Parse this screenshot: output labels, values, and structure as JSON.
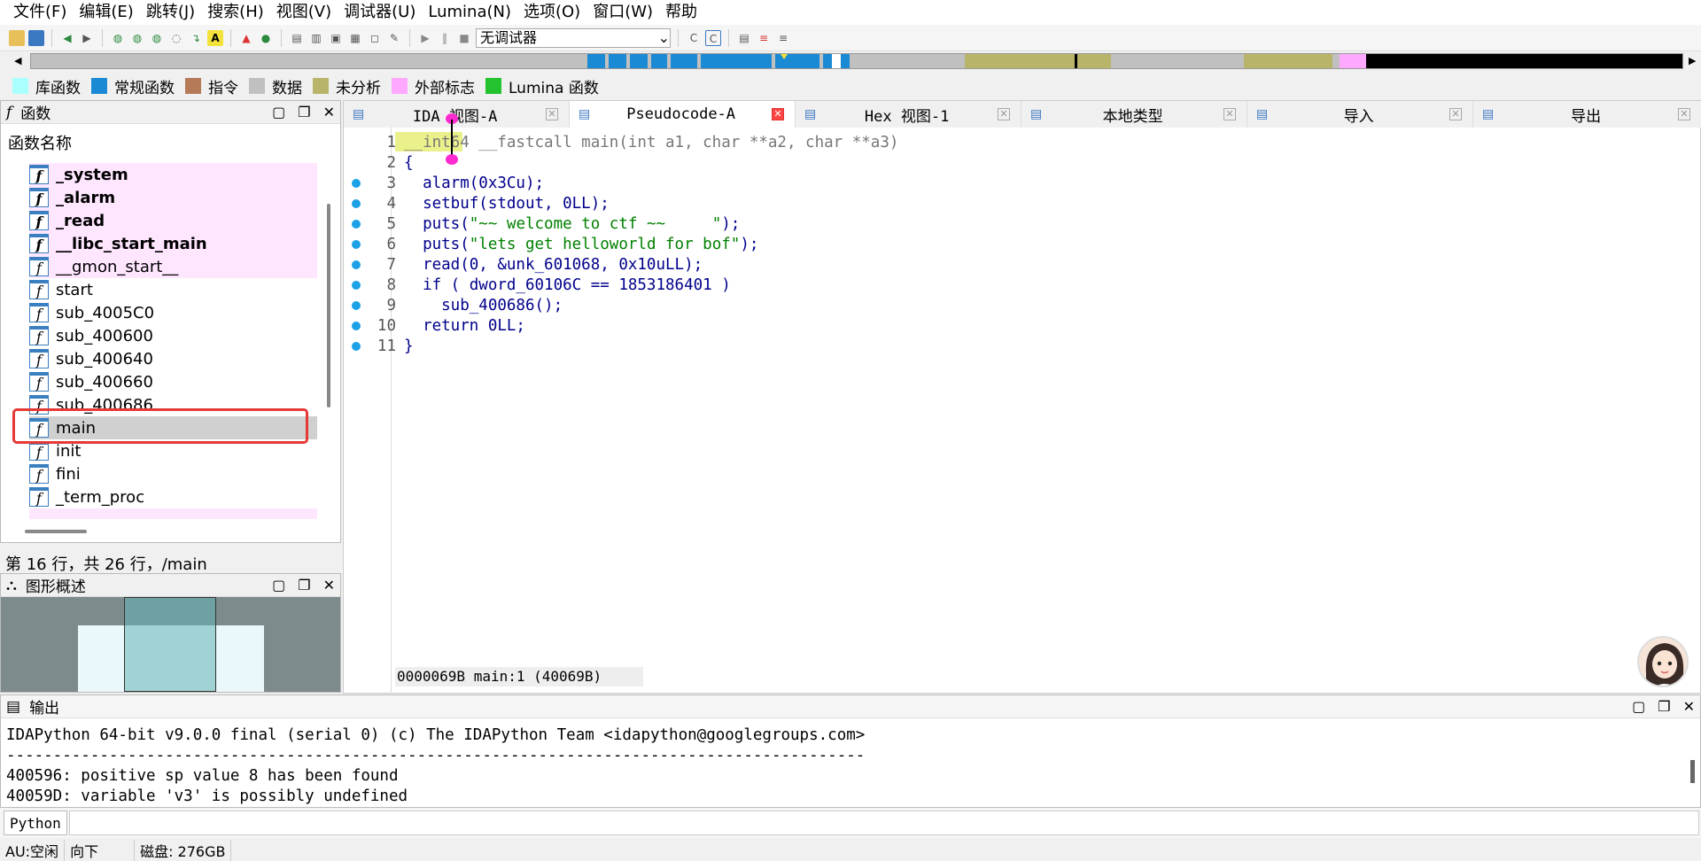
{
  "menu": [
    "文件(F)",
    "编辑(E)",
    "跳转(J)",
    "搜索(H)",
    "视图(V)",
    "调试器(U)",
    "Lumina(N)",
    "选项(O)",
    "窗口(W)",
    "帮助"
  ],
  "toolbar": {
    "debugger_select": "无调试器"
  },
  "legend": [
    {
      "label": "库函数",
      "color": "#aaffff"
    },
    {
      "label": "常规函数",
      "color": "#1a8ad4"
    },
    {
      "label": "指令",
      "color": "#b57a57"
    },
    {
      "label": "数据",
      "color": "#c0c0c0"
    },
    {
      "label": "未分析",
      "color": "#b8b56a"
    },
    {
      "label": "外部标志",
      "color": "#ffa8ff"
    },
    {
      "label": "Lumina 函数",
      "color": "#22c32e"
    }
  ],
  "functions_panel": {
    "title": "函数",
    "column_header": "函数名称",
    "items": [
      {
        "name": "_system",
        "lib": true,
        "bold": true
      },
      {
        "name": "_alarm",
        "lib": true,
        "bold": true
      },
      {
        "name": "_read",
        "lib": true,
        "bold": true
      },
      {
        "name": "__libc_start_main",
        "lib": true,
        "bold": true
      },
      {
        "name": "__gmon_start__",
        "lib": true,
        "bold": false
      },
      {
        "name": "start",
        "lib": false,
        "bold": false
      },
      {
        "name": "sub_4005C0",
        "lib": false,
        "bold": false
      },
      {
        "name": "sub_400600",
        "lib": false,
        "bold": false
      },
      {
        "name": "sub_400640",
        "lib": false,
        "bold": false
      },
      {
        "name": "sub_400660",
        "lib": false,
        "bold": false
      },
      {
        "name": "sub_400686",
        "lib": false,
        "bold": false
      },
      {
        "name": "main",
        "lib": false,
        "bold": false,
        "selected": true
      },
      {
        "name": "init",
        "lib": false,
        "bold": false
      },
      {
        "name": "fini",
        "lib": false,
        "bold": false
      },
      {
        "name": "_term_proc",
        "lib": false,
        "bold": false
      }
    ],
    "status": "第 16 行，共 26 行，/main"
  },
  "graph_panel": {
    "title": "图形概述"
  },
  "tabs": [
    {
      "label": "IDA 视图-A",
      "active": false
    },
    {
      "label": "Pseudocode-A",
      "active": true
    },
    {
      "label": "Hex 视图-1",
      "active": false
    },
    {
      "label": "本地类型",
      "active": false
    },
    {
      "label": "导入",
      "active": false
    },
    {
      "label": "导出",
      "active": false
    }
  ],
  "code": {
    "lines": [
      {
        "n": "1",
        "dot": false,
        "t": "__int64 __fastcall main(int a1, char **a2, char **a3)"
      },
      {
        "n": "2",
        "dot": false,
        "t": "{"
      },
      {
        "n": "3",
        "dot": true,
        "t": "  alarm(0x3Cu);"
      },
      {
        "n": "4",
        "dot": true,
        "t": "  setbuf(stdout, 0LL);"
      },
      {
        "n": "5",
        "dot": true,
        "t": "  puts(\"~~ welcome to ctf ~~     \");"
      },
      {
        "n": "6",
        "dot": true,
        "t": "  puts(\"lets get helloworld for bof\");"
      },
      {
        "n": "7",
        "dot": true,
        "t": "  read(0, &unk_601068, 0x10uLL);"
      },
      {
        "n": "8",
        "dot": true,
        "t": "  if ( dword_60106C == 1853186401 )"
      },
      {
        "n": "9",
        "dot": true,
        "t": "    sub_400686();"
      },
      {
        "n": "10",
        "dot": true,
        "t": "  return 0LL;"
      },
      {
        "n": "11",
        "dot": true,
        "t": "}"
      }
    ],
    "status": "0000069B main:1 (40069B)"
  },
  "output": {
    "title": "输出",
    "lines": [
      "IDAPython 64-bit v9.0.0 final (serial 0) (c) The IDAPython Team <idapython@googlegroups.com>",
      "--------------------------------------------------------------------------------------------",
      "400596: positive sp value 8 has been found",
      "40059D: variable 'v3' is possibly undefined"
    ]
  },
  "python_bar": {
    "button": "Python"
  },
  "statusbar": {
    "au": "AU:空闲",
    "dir": "向下",
    "disk": "磁盘: 276GB"
  }
}
